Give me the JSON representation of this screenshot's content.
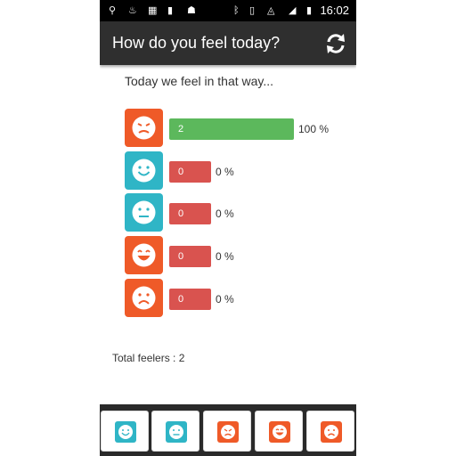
{
  "status_bar": {
    "time": "16:02",
    "left_icons": [
      "usb-icon",
      "flame-icon",
      "grid-icon",
      "sd-card-icon",
      "android-icon"
    ],
    "right_icons": [
      "bluetooth-icon",
      "vibrate-icon",
      "wifi-icon",
      "battery-icon"
    ]
  },
  "app_bar": {
    "title": "How do you feel today?",
    "action_icon": "refresh-icon"
  },
  "subtitle": "Today we feel in that way...",
  "moods": [
    {
      "icon": "angry-face-icon",
      "count_label": "2",
      "percent_label": "100 %",
      "fraction": 1.0,
      "bar_color": "#5cb85c",
      "tile_color": "#ef5a28"
    },
    {
      "icon": "happy-face-icon",
      "count_label": "0",
      "percent_label": "0 %",
      "fraction": 0.0,
      "bar_color": "#d9534f",
      "tile_color": "#2fb5c6"
    },
    {
      "icon": "neutral-face-icon",
      "count_label": "0",
      "percent_label": "0 %",
      "fraction": 0.0,
      "bar_color": "#d9534f",
      "tile_color": "#2fb5c6"
    },
    {
      "icon": "laughing-face-icon",
      "count_label": "0",
      "percent_label": "0 %",
      "fraction": 0.0,
      "bar_color": "#d9534f",
      "tile_color": "#ef5a28"
    },
    {
      "icon": "sad-face-icon",
      "count_label": "0",
      "percent_label": "0 %",
      "fraction": 0.0,
      "bar_color": "#d9534f",
      "tile_color": "#ef5a28"
    }
  ],
  "total_label": "Total feelers : 2",
  "bottom_buttons": [
    {
      "icon": "happy-face-icon",
      "tile_color": "#2fb5c6"
    },
    {
      "icon": "neutral-face-icon",
      "tile_color": "#2fb5c6"
    },
    {
      "icon": "angry-face-icon",
      "tile_color": "#ef5a28"
    },
    {
      "icon": "laughing-face-icon",
      "tile_color": "#ef5a28"
    },
    {
      "icon": "sad-face-icon",
      "tile_color": "#ef5a28"
    }
  ]
}
